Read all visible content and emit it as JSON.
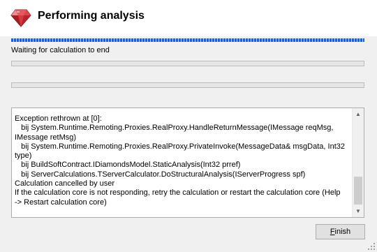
{
  "header": {
    "title": "Performing analysis",
    "icon": "ruby-gem-icon",
    "icon_color": "#c8262e"
  },
  "status": {
    "text": "Waiting for calculation to end"
  },
  "progress_bars": [
    {
      "value_percent": 0
    },
    {
      "value_percent": 0
    }
  ],
  "log": {
    "lines": [
      "Exception rethrown at [0]:",
      "   bij System.Runtime.Remoting.Proxies.RealProxy.HandleReturnMessage(IMessage reqMsg,",
      "IMessage retMsg)",
      "   bij System.Runtime.Remoting.Proxies.RealProxy.PrivateInvoke(MessageData& msgData, Int32",
      "type)",
      "   bij BuildSoftContract.IDiamondsModel.StaticAnalysis(Int32 prref)",
      "   bij ServerCalculations.TServerCalculator.DoStructuralAnalysis(IServerProgress spf)",
      "Calculation cancelled by user",
      "If the calculation core is not responding, retry the calculation or restart the calculation core (Help",
      "-> Restart calculation core)"
    ]
  },
  "buttons": {
    "finish_accesskey": "F",
    "finish_rest": "inish"
  },
  "colors": {
    "accent": "#1f5fd0",
    "progress_fill": "#06b025"
  }
}
